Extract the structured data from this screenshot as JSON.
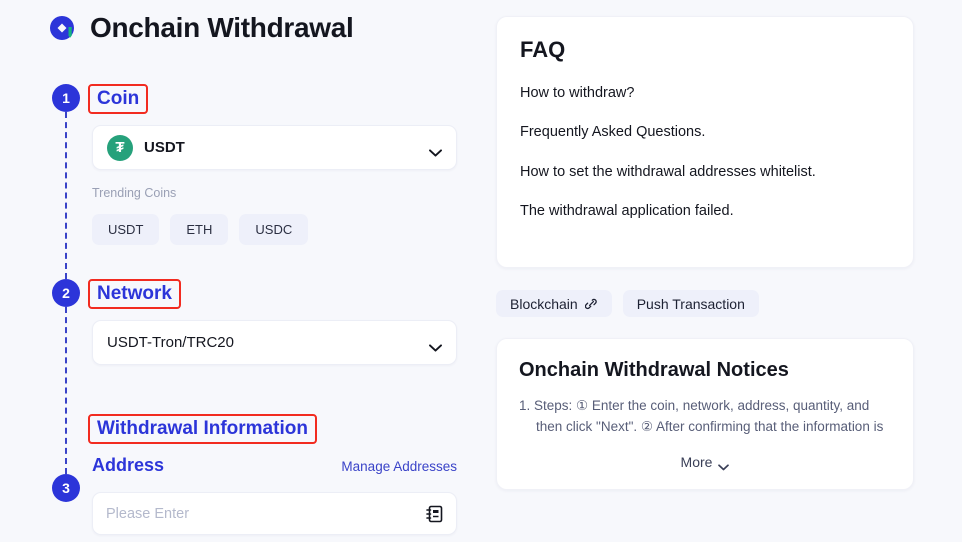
{
  "header": {
    "title": "Onchain Withdrawal",
    "logo_icon": "brand-logo-icon"
  },
  "steps": [
    {
      "number": "1",
      "label": "Coin"
    },
    {
      "number": "2",
      "label": "Network"
    },
    {
      "number": "3",
      "label": "Withdrawal Information"
    }
  ],
  "coin_section": {
    "selected_coin": "USDT",
    "coin_symbol_glyph": "₮",
    "coin_icon_color": "#26a17b",
    "chevron_icon": "chevron-down-icon",
    "trending_label": "Trending Coins",
    "trending_coins": [
      "USDT",
      "ETH",
      "USDC"
    ]
  },
  "network_section": {
    "selected_network": "USDT-Tron/TRC20",
    "chevron_icon": "chevron-down-icon"
  },
  "withdrawal_section": {
    "address_label": "Address",
    "manage_addresses_link": "Manage Addresses",
    "address_placeholder": "Please Enter",
    "address_book_icon": "address-book-icon"
  },
  "faq": {
    "title": "FAQ",
    "items": [
      "How to withdraw?",
      "Frequently Asked Questions.",
      "How to set the withdrawal addresses whitelist.",
      "The withdrawal application failed."
    ]
  },
  "action_pills": [
    {
      "label": "Blockchain",
      "icon": "external-link-icon"
    },
    {
      "label": "Push Transaction",
      "icon": ""
    }
  ],
  "notices": {
    "title": "Onchain Withdrawal Notices",
    "body": "1. Steps: ① Enter the coin, network, address, quantity, and then click \"Next\". ② After confirming that the information is",
    "more_label": "More",
    "more_icon": "chevron-down-icon"
  },
  "colors": {
    "accent_blue": "#2c35d9",
    "annotation_red": "#f22b20",
    "page_bg": "#f7f8fc",
    "chip_bg": "#eef0fa"
  }
}
